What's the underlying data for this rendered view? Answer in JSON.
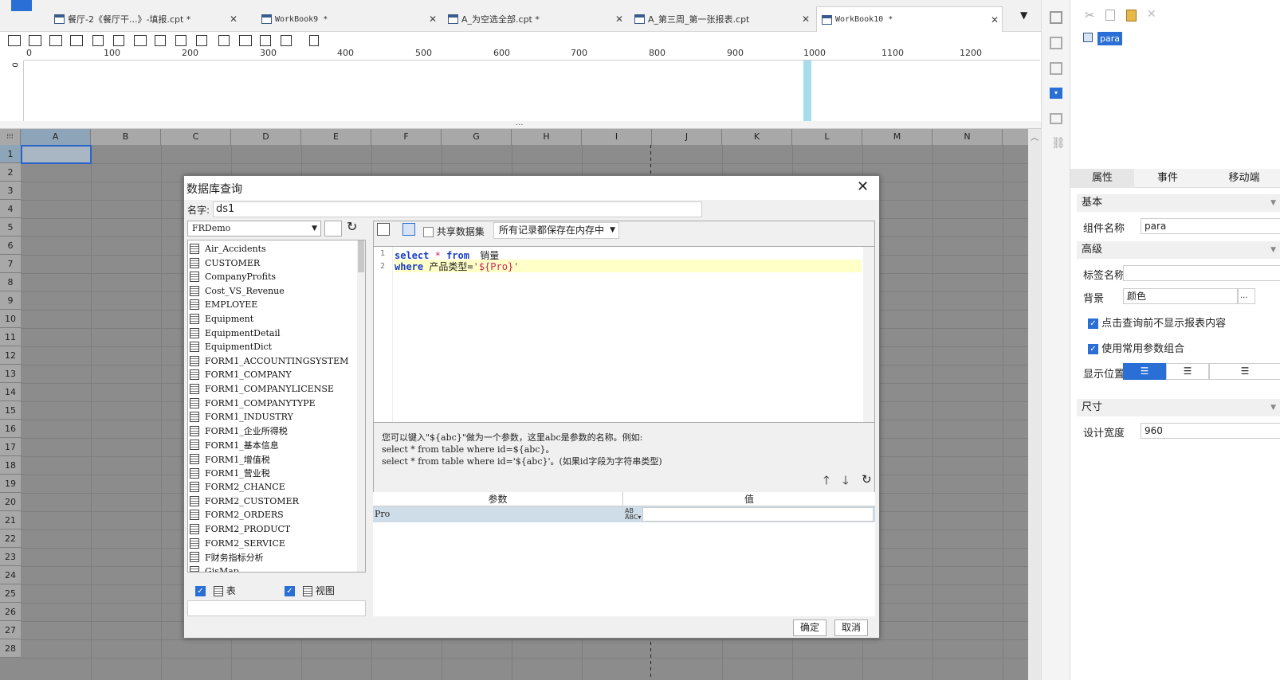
{
  "tabs": [
    {
      "label": "餐厅-2《餐厅干...》-填报.cpt *"
    },
    {
      "label": "WorkBook9 *"
    },
    {
      "label": "A_为空选全部.cpt *"
    },
    {
      "label": "A_第三周_第一张报表.cpt"
    },
    {
      "label": "WorkBook10 *"
    }
  ],
  "ruler": {
    "zero": "0",
    "labels": [
      "100",
      "200",
      "300",
      "400",
      "500",
      "600",
      "700",
      "800",
      "900",
      "1000",
      "1100",
      "1200"
    ]
  },
  "sheet": {
    "columns": [
      "A",
      "B",
      "C",
      "D",
      "E",
      "F",
      "G",
      "H",
      "I",
      "J",
      "K",
      "L",
      "M",
      "N"
    ],
    "rows": [
      "1",
      "2",
      "3",
      "4",
      "5",
      "6",
      "7",
      "8",
      "9",
      "10",
      "11",
      "12",
      "13",
      "14",
      "15",
      "16",
      "17",
      "18",
      "19",
      "20",
      "21",
      "22",
      "23",
      "24",
      "25",
      "26",
      "27",
      "28"
    ]
  },
  "right_panel": {
    "widget_name": "para",
    "tabs": [
      "属性",
      "事件",
      "移动端"
    ],
    "basic_label": "基本",
    "component_name_label": "组件名称",
    "component_name_value": "para",
    "advanced_label": "高级",
    "tag_name_label": "标签名称",
    "tag_name_value": "",
    "background_label": "背景",
    "background_value": "颜色",
    "more_label": "...",
    "check1": "点击查询前不显示报表内容",
    "check2": "使用常用参数组合",
    "position_label": "显示位置",
    "size_label": "尺寸",
    "design_width_label": "设计宽度",
    "design_width_value": "960"
  },
  "dialog": {
    "title": "数据库查询",
    "name_label": "名字:",
    "name_value": "ds1",
    "connection": "FRDemo",
    "tables": [
      "Air_Accidents",
      "CUSTOMER",
      "CompanyProfits",
      "Cost_VS_Revenue",
      "EMPLOYEE",
      "Equipment",
      "EquipmentDetail",
      "EquipmentDict",
      "FORM1_ACCOUNTINGSYSTEM",
      "FORM1_COMPANY",
      "FORM1_COMPANYLICENSE",
      "FORM1_COMPANYTYPE",
      "FORM1_INDUSTRY",
      "FORM1_企业所得税",
      "FORM1_基本信息",
      "FORM1_增值税",
      "FORM1_营业税",
      "FORM2_CHANCE",
      "FORM2_CUSTOMER",
      "FORM2_ORDERS",
      "FORM2_PRODUCT",
      "FORM2_SERVICE",
      "F财务指标分析",
      "GisMap"
    ],
    "show_tables_label": "表",
    "show_views_label": "视图",
    "share_dataset_label": "共享数据集",
    "memory_option": "所有记录都保存在内存中",
    "sql_line1_no": "1",
    "sql_line2_no": "2",
    "sql_kw_select": "select",
    "sql_star": "*",
    "sql_kw_from": "from",
    "sql_table": "销量",
    "sql_kw_where": "where",
    "sql_field": "产品类型=",
    "sql_param": "'${Pro}'",
    "hint1": "您可以键入\"${abc}\"做为一个参数，这里abc是参数的名称。例如:",
    "hint2": "select * from table where id=${abc}。",
    "hint3": "select * from table where id='${abc}'。(如果id字段为字符串类型)",
    "param_col": "参数",
    "value_col": "值",
    "param_name": "Pro",
    "param_value": "",
    "ok_label": "确定",
    "cancel_label": "取消"
  },
  "colors": {
    "accent": "#2a6fd6",
    "highlight_line": "#ffffc8",
    "selected_param_row": "#cfdde9",
    "sql_keyword": "#1a3cc8",
    "sql_string": "#c8285a"
  }
}
